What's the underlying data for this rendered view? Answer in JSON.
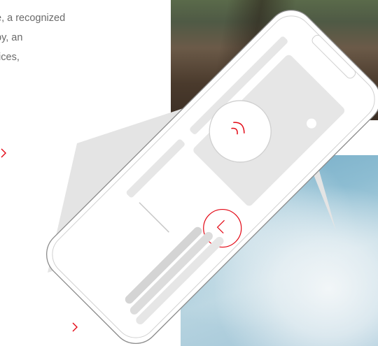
{
  "intro": {
    "lines": [
      "e, a recognized",
      "py, an",
      "tices,"
    ]
  },
  "icons": {
    "left_link": "chevron-right-icon",
    "bottom_link": "chevron-right-icon",
    "nfc": "nfc-signal-icon",
    "clock": "clock-icon"
  },
  "colors": {
    "accent": "#e30613",
    "text": "#6a6a6a",
    "phone_outline": "#8c8c8c",
    "placeholder": "#e6e6e6",
    "shape": "#e4e4e4"
  }
}
